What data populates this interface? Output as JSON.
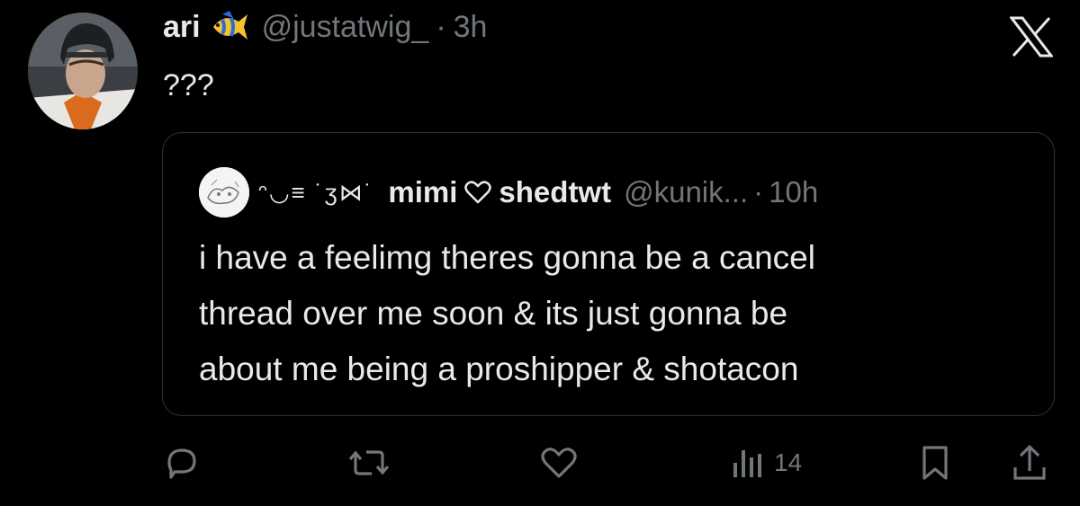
{
  "tweet": {
    "author_name": "ari",
    "author_handle": "@justatwig_",
    "separator": "·",
    "time": "3h",
    "text": "???",
    "name_emoji_icon": "tropical-fish-icon",
    "avatar_icon": "hockey-player-avatar"
  },
  "quoted": {
    "decoration": "ᵔ◡≡ ˙ʒ⋈˙",
    "name_part1": "mimi",
    "name_heart_icon": "heart-outline-icon",
    "name_part2": "shedtwt",
    "handle": "@kunik...",
    "separator": "·",
    "time": "10h",
    "lines": [
      "i have a feelimg theres gonna be a cancel",
      "thread over me soon & its just gonna be",
      "about me being a proshipper & shotacon"
    ]
  },
  "actions": {
    "reply_icon": "reply-icon",
    "retweet_icon": "retweet-icon",
    "like_icon": "like-icon",
    "views_icon": "views-icon",
    "views_count": "14",
    "bookmark_icon": "bookmark-icon",
    "share_icon": "share-icon"
  },
  "app": {
    "logo": "x-logo-icon"
  },
  "colors": {
    "background": "#000000",
    "text_primary": "#e7e9ea",
    "text_secondary": "#71767b",
    "border": "#2f3336"
  }
}
